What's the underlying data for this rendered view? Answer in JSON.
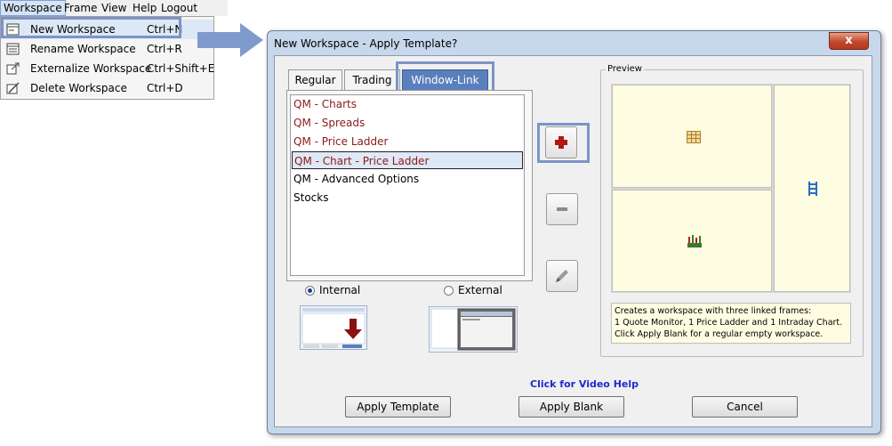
{
  "menubar": {
    "items": [
      {
        "label": "Workspace"
      },
      {
        "label": "Frame"
      },
      {
        "label": "View"
      },
      {
        "label": "Help"
      },
      {
        "label": "Logout"
      }
    ]
  },
  "workspace_menu": {
    "items": [
      {
        "label": "New Workspace",
        "shortcut": "Ctrl+N",
        "icon": "new-workspace-icon"
      },
      {
        "label": "Rename Workspace",
        "shortcut": "Ctrl+R",
        "icon": "rename-workspace-icon"
      },
      {
        "label": "Externalize Workspace",
        "shortcut": "Ctrl+Shift+E",
        "icon": "externalize-workspace-icon"
      },
      {
        "label": "Delete Workspace",
        "shortcut": "Ctrl+D",
        "icon": "delete-workspace-icon"
      }
    ]
  },
  "dialog": {
    "title": "New Workspace - Apply Template?",
    "close_label": "x",
    "tabs": [
      {
        "label": "Regular"
      },
      {
        "label": "Trading"
      },
      {
        "label": "Window-Link",
        "selected": true
      }
    ],
    "templates": [
      {
        "label": "QM - Charts",
        "color": "#8b1a1a"
      },
      {
        "label": "QM - Spreads",
        "color": "#8b1a1a"
      },
      {
        "label": "QM - Price Ladder",
        "color": "#8b1a1a"
      },
      {
        "label": "QM - Chart - Price Ladder",
        "color": "#8b1a1a",
        "selected": true
      },
      {
        "label": "QM - Advanced Options",
        "color": "#000000"
      },
      {
        "label": "Stocks",
        "color": "#000000"
      }
    ],
    "side_buttons": {
      "add_icon": "plus-icon",
      "remove_icon": "minus-icon",
      "edit_icon": "pencil-icon"
    },
    "mode": {
      "internal_label": "Internal",
      "external_label": "External",
      "selected": "internal"
    },
    "preview": {
      "label": "Preview",
      "description_lines": [
        "Creates a workspace with three linked frames:",
        "1 Quote Monitor, 1 Price Ladder and 1 Intraday Chart.",
        "Click Apply Blank for a regular empty workspace."
      ]
    },
    "video_help": "Click for Video Help",
    "buttons": {
      "apply_template": "Apply Template",
      "apply_blank": "Apply Blank",
      "cancel": "Cancel"
    }
  },
  "colors": {
    "accent": "#5a7fbd",
    "highlight_border": "#7b94c8",
    "preview_pane": "#fffde1",
    "link": "#1f2bcf",
    "template_red": "#8b1a1a"
  }
}
